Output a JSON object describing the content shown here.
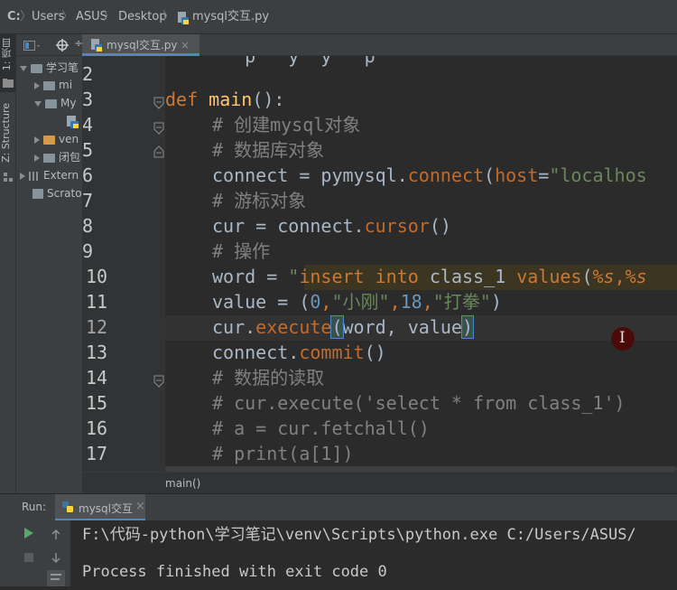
{
  "breadcrumb": {
    "drive": "C:",
    "items": [
      "Users",
      "ASUS",
      "Desktop"
    ],
    "file": "mysql交互.py",
    "separator": "〉"
  },
  "left_stripe": {
    "project_tab": "1: 项目",
    "structure_tab": "Z: Structure"
  },
  "project_panel": {
    "rows": [
      {
        "label": "学习笔",
        "arrow": "down"
      },
      {
        "label": "mi",
        "arrow": "right"
      },
      {
        "label": "My",
        "arrow": "down"
      },
      {
        "label": "",
        "arrow": "none"
      },
      {
        "label": "ven",
        "arrow": "right"
      },
      {
        "label": "闭包",
        "arrow": "right"
      },
      {
        "label": "Extern",
        "arrow": "right"
      },
      {
        "label": "Scrato",
        "arrow": "none"
      }
    ]
  },
  "editor_tab": {
    "label": "mysql交互.py",
    "close": "×"
  },
  "line_numbers": [
    "2",
    "3",
    "4",
    "5",
    "6",
    "7",
    "8",
    "9",
    "10",
    "11",
    "12",
    "13",
    "14",
    "15",
    "16",
    "17"
  ],
  "code": {
    "line3": {
      "kw": "def",
      "name": "main",
      "rest": "():"
    },
    "line4": "# 创建mysql对象",
    "line5": "# 数据库对象",
    "line6": {
      "a": "connect = pymysql.",
      "m": "connect",
      "b": "(",
      "p": "host",
      "c": "=",
      "s": "\"localhos"
    },
    "line7": "# 游标对象",
    "line8": {
      "a": "cur = connect.",
      "m": "cursor",
      "b": "()"
    },
    "line9": "# 操作",
    "line10": {
      "a": "word = ",
      "q": "\"",
      "i1": "insert",
      "sp1": " ",
      "i2": "into",
      "sp2": " ",
      "t": "class_1",
      "sp3": " ",
      "v": "values",
      "o": "(",
      "f1": "%s",
      "cm": ",",
      "f2": "%s"
    },
    "line11": {
      "a": "value = (",
      "n1": "0",
      "c1": ",",
      "s1": "\"小刚\"",
      "c2": ",",
      "n2": "18",
      "c3": ",",
      "s2": "\"打拳\"",
      "b": ")"
    },
    "line12": {
      "a": "cur.",
      "m": "execute",
      "o": "(",
      "args": "word, value",
      "c": ")"
    },
    "line13": {
      "a": "connect.",
      "m": "commit",
      "b": "()"
    },
    "line14": "# 数据的读取",
    "line15": "# cur.execute('select * from class_1')",
    "line16": "# a = cur.fetchall()",
    "line17": "# print(a[1])"
  },
  "footer_crumb": "main()",
  "run_panel": {
    "label": "Run:",
    "tab": "mysql交互",
    "close": "×",
    "output_line1": "F:\\代码-python\\学习笔记\\venv\\Scripts\\python.exe C:/Users/ASUS/",
    "output_line2": "Process finished with exit code 0"
  },
  "colors": {
    "accent": "#4a88c7",
    "keyword": "#cc7832",
    "function": "#ffc66d",
    "comment": "#808080",
    "string": "#6a8759",
    "number": "#6897bb"
  }
}
